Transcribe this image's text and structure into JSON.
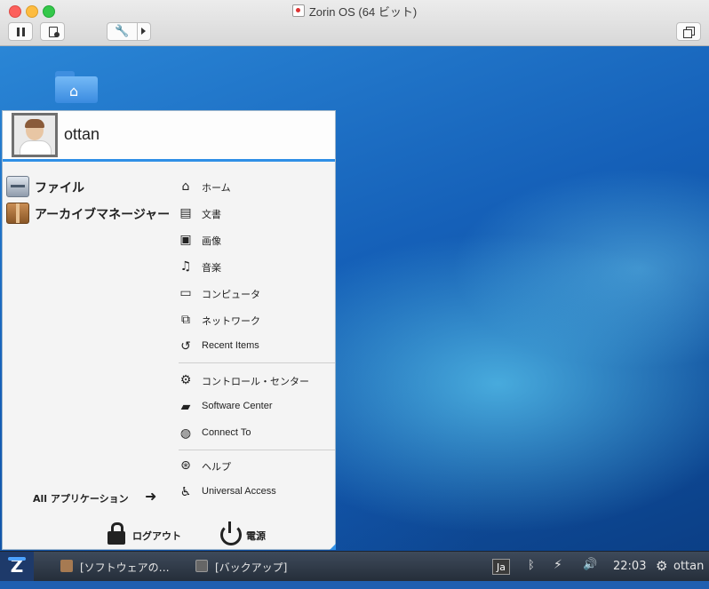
{
  "window": {
    "title": "Zorin OS (64 ビット)"
  },
  "toolbar": {
    "pause_icon": "pause-icon",
    "snapshot_icon": "snapshot-icon",
    "settings_icon": "wrench-icon",
    "restore_icon": "restore-window-icon"
  },
  "desktop": {
    "icons": [
      {
        "name": "home-folder-icon"
      }
    ]
  },
  "menu": {
    "username": "ottan",
    "favorites": [
      {
        "label": "ファイル",
        "icon": "file-manager-icon"
      },
      {
        "label": "アーカイブマネージャー",
        "icon": "archive-manager-icon"
      }
    ],
    "places": [
      {
        "label": "ホーム",
        "icon": "home-icon",
        "glyph": "⌂"
      },
      {
        "label": "文書",
        "icon": "documents-icon",
        "glyph": "▤"
      },
      {
        "label": "画像",
        "icon": "pictures-icon",
        "glyph": "▣"
      },
      {
        "label": "音楽",
        "icon": "music-icon",
        "glyph": "♫"
      },
      {
        "label": "コンピュータ",
        "icon": "computer-icon",
        "glyph": "▭"
      },
      {
        "label": "ネットワーク",
        "icon": "network-icon",
        "glyph": "⧉"
      },
      {
        "label": "Recent Items",
        "icon": "recent-items-icon",
        "glyph": "↺"
      },
      {
        "label": "コントロール・センター",
        "icon": "control-center-icon",
        "glyph": "⚙"
      },
      {
        "label": "Software Center",
        "icon": "software-center-icon",
        "glyph": "▰"
      },
      {
        "label": "Connect To",
        "icon": "connect-to-icon",
        "glyph": "◍"
      },
      {
        "label": "ヘルプ",
        "icon": "help-icon",
        "glyph": "⊛"
      },
      {
        "label": "Universal Access",
        "icon": "universal-access-icon",
        "glyph": "♿"
      }
    ],
    "all_apps_label": "All アプリケーション",
    "logout_label": "ログアウト",
    "power_label": "電源"
  },
  "taskbar": {
    "tasks": [
      {
        "label": "[ソフトウェアの…",
        "icon": "software-updater-icon"
      },
      {
        "label": "[バックアップ]",
        "icon": "backup-icon"
      }
    ],
    "tray": {
      "input_method": "Ja",
      "bluetooth_icon": "bluetooth-icon",
      "network_icon": "network-plug-icon",
      "volume_icon": "volume-icon",
      "time": "22:03",
      "settings_icon": "gear-icon",
      "user": "ottan"
    }
  }
}
